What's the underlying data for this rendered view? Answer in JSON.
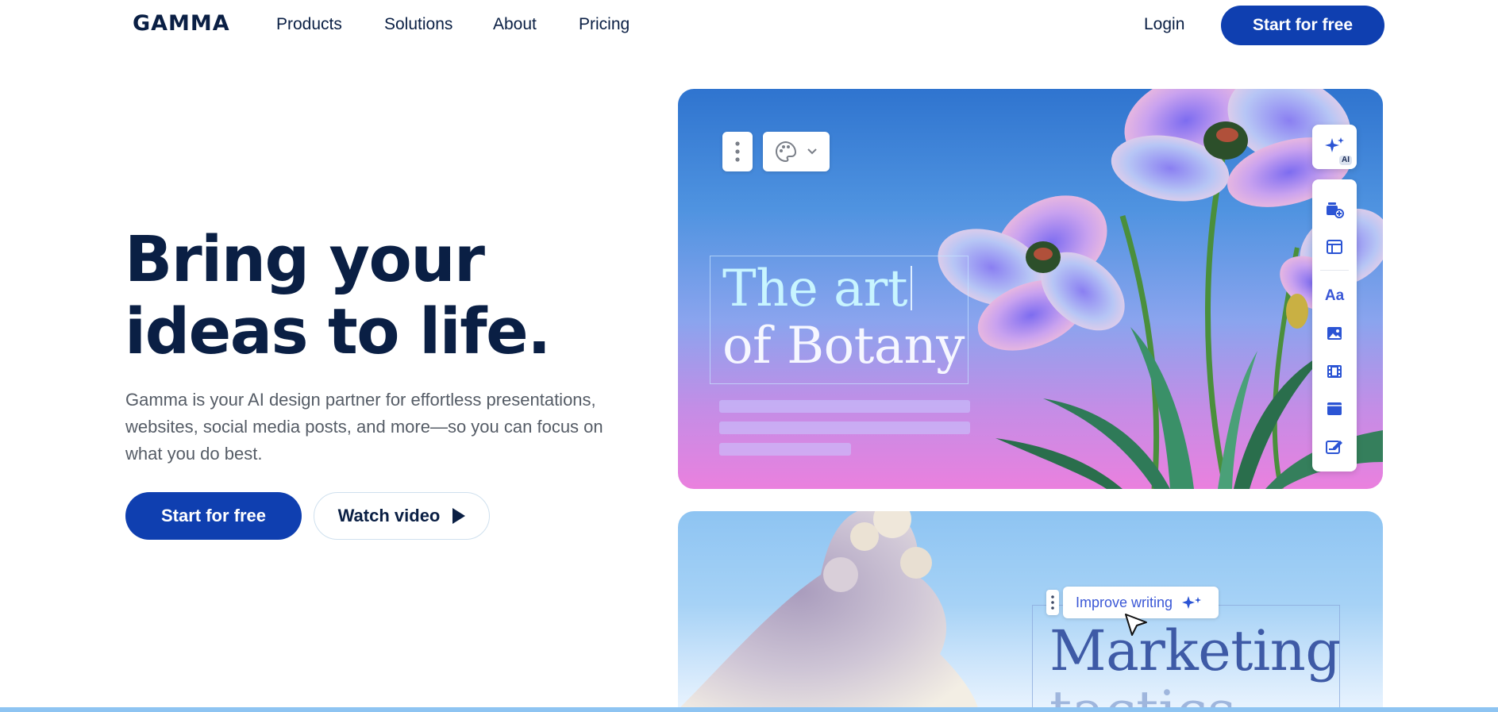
{
  "nav": {
    "logo": "GAMMA",
    "links": [
      "Products",
      "Solutions",
      "About",
      "Pricing"
    ],
    "login": "Login",
    "cta": "Start for free"
  },
  "hero": {
    "headline_line1": "Bring your",
    "headline_line2": "ideas to life.",
    "subtext": "Gamma is your AI design partner for effortless presentations, websites, social media posts, and more—so you can focus on what you do best.",
    "primary_button": "Start for free",
    "secondary_button": "Watch video"
  },
  "card1": {
    "title_line1": "The art",
    "title_line2": "of Botany",
    "ai_badge": "AI",
    "toolbar_icons": [
      "menu-dots-icon",
      "palette-icon",
      "chevron-down-icon"
    ],
    "side_tools": [
      "add-card-icon",
      "layout-icon",
      "text-icon",
      "image-icon",
      "video-icon",
      "embed-icon",
      "form-icon"
    ],
    "text_tool_label": "Aa"
  },
  "card2": {
    "improve_label": "Improve writing",
    "title_line1": "Marketing",
    "title_line2": "tactics"
  },
  "colors": {
    "brand": "#0f3fb0",
    "text": "#0a1f44",
    "accent_tool": "#3a57d6"
  }
}
